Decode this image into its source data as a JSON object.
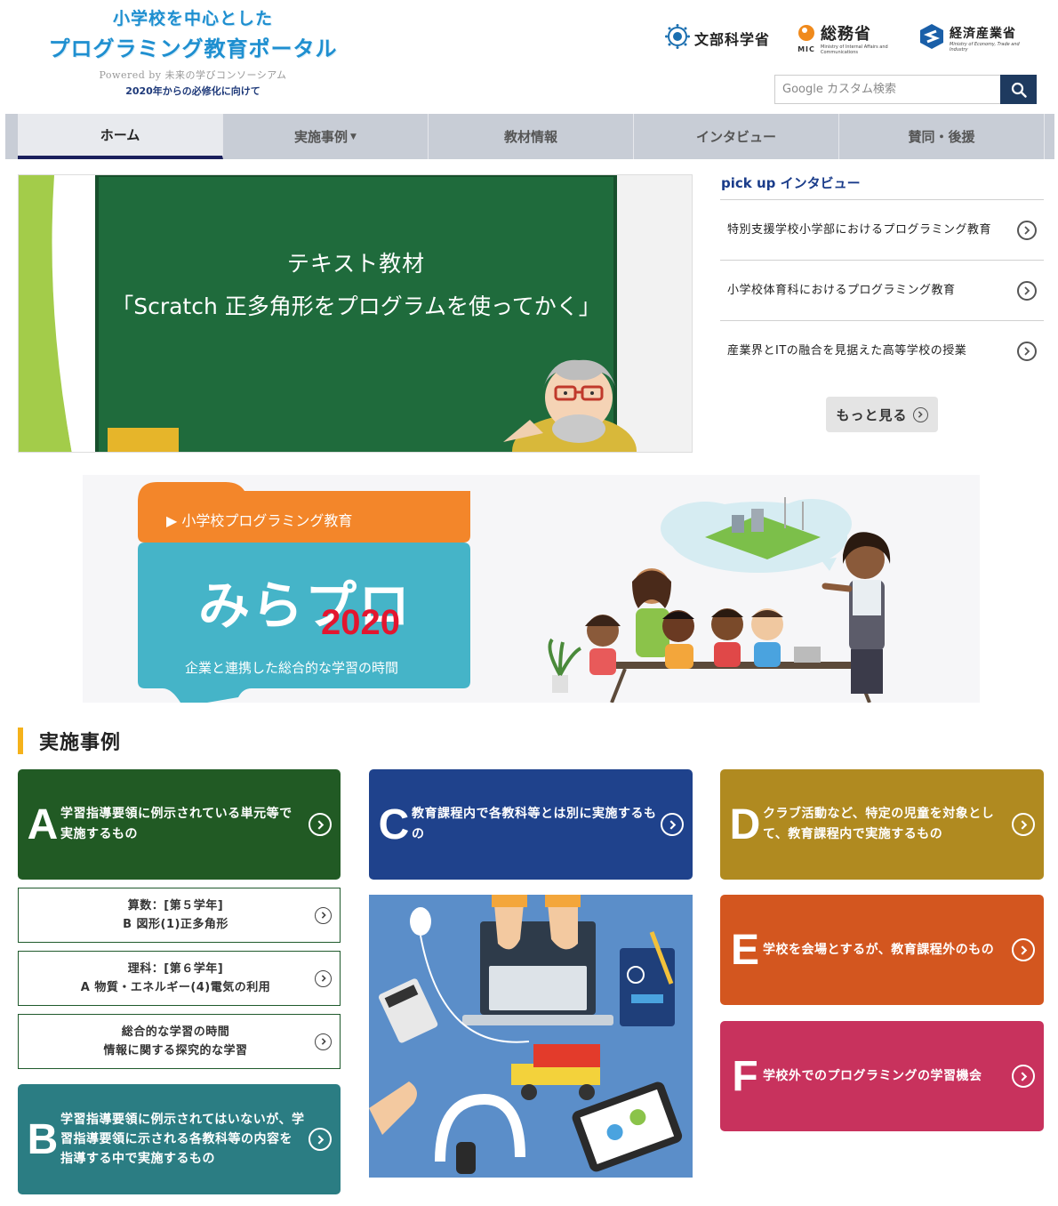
{
  "header": {
    "title_line1": "小学校を中心とした",
    "title_line2": "プログラミング教育ポータル",
    "powered_by": "Powered by 未来の学びコンソーシアム",
    "subtitle": "2020年からの必修化に向けて"
  },
  "ministries": [
    {
      "name": "文部科学省",
      "icon": "mext-logo-icon"
    },
    {
      "name": "総務省",
      "abbr": "MIC",
      "sub": "Ministry of Internal Affairs and Communications",
      "icon": "mic-logo-icon"
    },
    {
      "name": "経済産業省",
      "sub": "Ministry of Economy, Trade and Industry",
      "icon": "meti-logo-icon"
    }
  ],
  "search": {
    "placeholder": "Google カスタム検索",
    "icon": "search-icon"
  },
  "nav": [
    {
      "label": "ホーム",
      "active": true
    },
    {
      "label": "実施事例",
      "dropdown": true
    },
    {
      "label": "教材情報"
    },
    {
      "label": "インタビュー"
    },
    {
      "label": "賛同・後援"
    }
  ],
  "hero": {
    "line1": "テキスト教材",
    "line2": "「Scratch 正多角形をプログラムを使ってかく」"
  },
  "pickup": {
    "title": "pick up インタビュー",
    "items": [
      "特別支援学校小学部におけるプログラミング教育",
      "小学校体育科におけるプログラミング教育",
      "産業界とITの融合を見据えた高等学校の授業"
    ],
    "more": "もっと見る"
  },
  "banner": {
    "tag": "▶ 小学校プログラミング教育",
    "title": "みらプロ",
    "year": "2020",
    "caption": "企業と連携した総合的な学習の時間"
  },
  "section": {
    "title": "実施事例"
  },
  "cases": {
    "A": {
      "letter": "A",
      "text": "学習指導要領に例示されている単元等で実施するもの",
      "color": "#215a24"
    },
    "B": {
      "letter": "B",
      "text": "学習指導要領に例示されてはいないが、学習指導要領に示される各教科等の内容を指導する中で実施するもの",
      "color": "#2b7d83"
    },
    "C": {
      "letter": "C",
      "text": "教育課程内で各教科等とは別に実施するもの",
      "color": "#1f428c"
    },
    "D": {
      "letter": "D",
      "text": "クラブ活動など、特定の児童を対象として、教育課程内で実施するもの",
      "color": "#b08a20"
    },
    "E": {
      "letter": "E",
      "text": "学校を会場とするが、教育課程外のもの",
      "color": "#d3561f"
    },
    "F": {
      "letter": "F",
      "text": "学校外でのプログラミングの学習機会",
      "color": "#c8325d"
    }
  },
  "subjects": [
    {
      "line1": "算数：[第５学年]",
      "line2": "B 図形(1)正多角形"
    },
    {
      "line1": "理科：[第６学年]",
      "line2": "A 物質・エネルギー(4)電気の利用"
    },
    {
      "line1": "総合的な学習の時間",
      "line2": "情報に関する探究的な学習"
    }
  ]
}
